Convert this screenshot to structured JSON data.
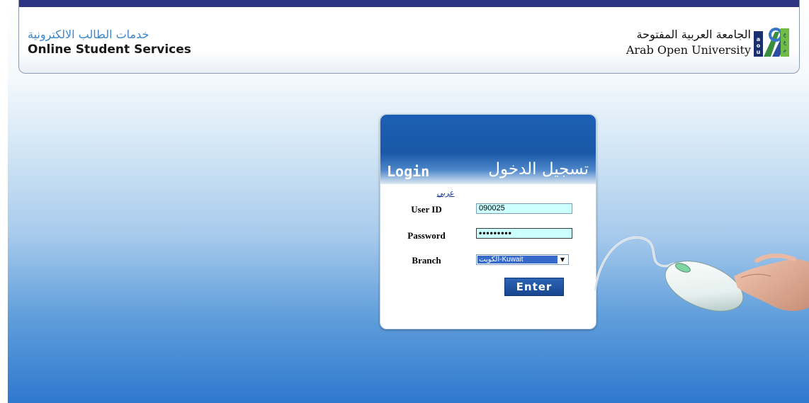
{
  "header": {
    "services_ar": "خدمات الطالب الالكترونية",
    "services_en": "Online Student Services",
    "university_ar": "الجامعة العربية المفتوحة",
    "university_en": "Arab Open University",
    "logo_letters": "AOU"
  },
  "login": {
    "title_en": "Login",
    "title_ar": "تسجيل الدخول",
    "language_link": "عربي",
    "user_id_label": "User ID",
    "user_id_value": "090025",
    "password_label": "Password",
    "password_value": "•••••••••",
    "branch_label": "Branch",
    "branch_value": "الكويت-Kuwait",
    "enter_label": "Enter"
  },
  "colors": {
    "header_bar": "#2e3482",
    "login_head": "#1c5fb2",
    "input_bg": "#ccffff",
    "button": "#1f55a3"
  }
}
